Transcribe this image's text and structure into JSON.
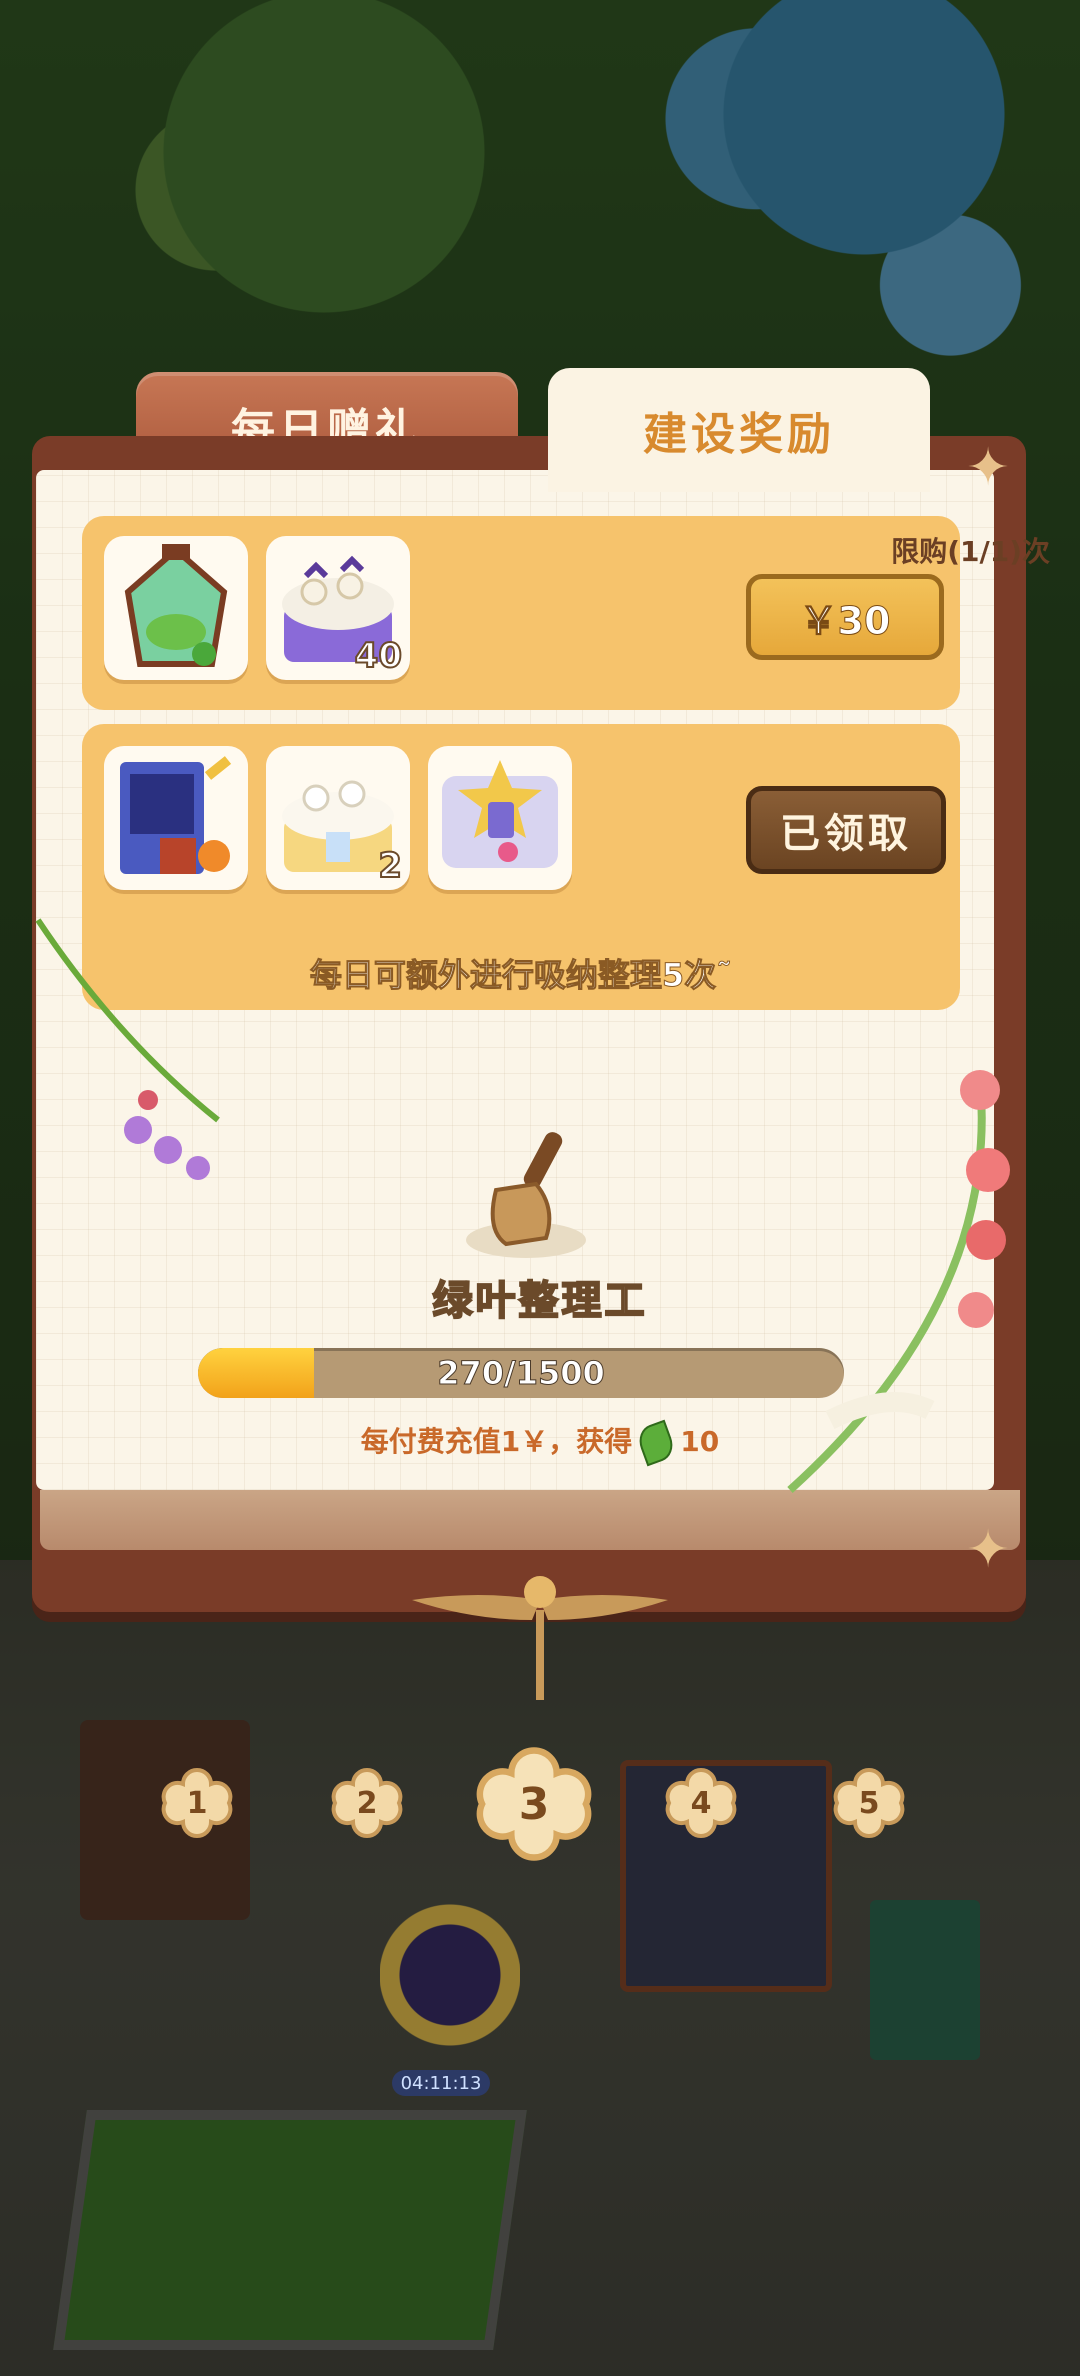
{
  "tabs": {
    "daily_gift": "每日赠礼",
    "build_reward": "建设奖励"
  },
  "row1": {
    "limit_text": "限购(1/1)次",
    "price": "￥30",
    "items": [
      {
        "icon": "terrarium-icon",
        "count": ""
      },
      {
        "icon": "cake-pack-icon",
        "count": "40"
      }
    ]
  },
  "row2": {
    "claimed_label": "已领取",
    "perk_text": "每日可额外进行吸纳整理5次˜",
    "items": [
      {
        "icon": "cabinet-icon",
        "count": ""
      },
      {
        "icon": "cream-cake-icon",
        "count": "2"
      },
      {
        "icon": "gift-card-icon",
        "count": ""
      }
    ]
  },
  "level": {
    "title": "绿叶整理工",
    "progress_text": "270/1500",
    "progress_fraction": 0.18,
    "earn_text_prefix": "每付费充值1￥，获得",
    "earn_amount": "10"
  },
  "selector": {
    "levels": [
      "1",
      "2",
      "3",
      "4",
      "5"
    ],
    "active": "3"
  },
  "world": {
    "timer": "04:11:13"
  },
  "colors": {
    "accent": "#f6c36c",
    "tab_active_text": "#d88a2e",
    "panel_border": "#7a3c28"
  }
}
